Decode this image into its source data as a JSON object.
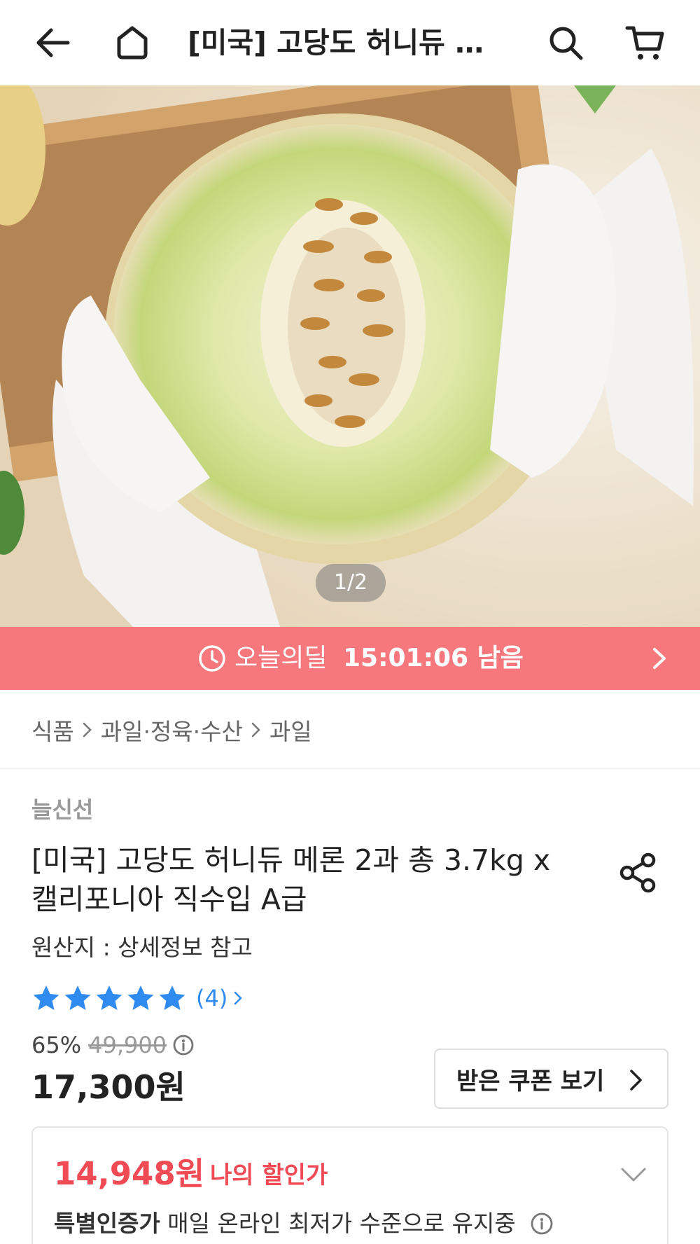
{
  "header": {
    "title": "[미국] 고당도 허니듀 메론 2과 총 3.7kg x 캘리포니아 직수입 A급",
    "back_icon": "arrow-left-icon",
    "home_icon": "home-icon",
    "search_icon": "search-icon",
    "cart_icon": "cart-icon"
  },
  "gallery": {
    "page_indicator": "1/2"
  },
  "deal": {
    "label": "오늘의딜",
    "time_left": "15:01:06 남음",
    "color": "#f6777c"
  },
  "breadcrumb": {
    "items": [
      "식품",
      "과일·정육·수산",
      "과일"
    ]
  },
  "product": {
    "seller": "늘신선",
    "title_line1": "[미국] 고당도 허니듀 메론 2과 총 3.7kg x",
    "title_line2": "캘리포니아 직수입 A급",
    "origin": "원산지 : 상세정보 참고",
    "rating_stars": 5,
    "review_count": "(4)",
    "discount_rate": "65%",
    "original_price": "49,900",
    "sale_price": "17,300원",
    "coupon_button": "받은 쿠폰 보기"
  },
  "my_deal": {
    "price": "14,948원",
    "label": "나의 할인가",
    "desc_bold": "특별인증가",
    "desc_rest": " 매일 온라인 최저가 수준으로 유지중",
    "accent_color": "#f04a55"
  }
}
